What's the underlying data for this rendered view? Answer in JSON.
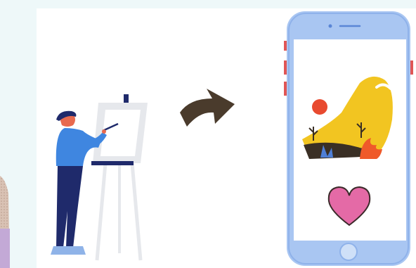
{
  "scene": {
    "colors": {
      "background": "#eef8f9",
      "card": "#ffffff",
      "arrow": "#4a3b2c",
      "phone_frame": "#a9c6f2",
      "phone_edge": "#8fb2ea",
      "phone_side_buttons": "#e05656",
      "figure_shirt": "#3f86e0",
      "figure_pants": "#1f2a6b",
      "figure_hair": "#e86a4f",
      "figure_hat": "#1f2a6b",
      "figure_shoes": "#8fb3e8",
      "easel": "#e6e8ec",
      "canvas_board": "#eef0f3",
      "art_yellow": "#f2c521",
      "art_red_sun": "#e84a2f",
      "art_ground": "#3a2f25",
      "art_blue_plant": "#4f7fd6",
      "art_flame": "#ef5a2a",
      "heart_fill": "#e46aa6",
      "heart_stroke": "#3b2a2a"
    },
    "icons": [
      "painter-figure",
      "easel",
      "arrow-right-icon",
      "smartphone",
      "heart-icon"
    ]
  }
}
